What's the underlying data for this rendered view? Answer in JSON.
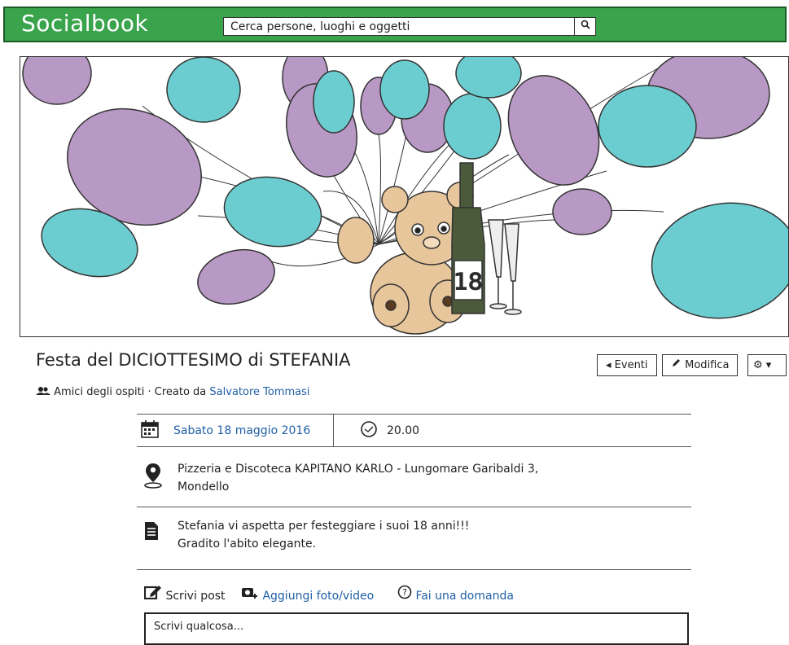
{
  "app": {
    "brand": "Socialbook"
  },
  "search": {
    "placeholder": "Cerca persone, luoghi e oggetti"
  },
  "event": {
    "title": "Festa del DICIOTTESIMO di STEFANIA",
    "privacy": "Amici degli ospiti",
    "created_by_label": "· Creato da",
    "creator": "Salvatore Tommasi",
    "date": "Sabato 18 maggio 2016",
    "time": "20.00",
    "location_line1": "Pizzeria e Discoteca KAPITANO KARLO - Lungomare Garibaldi 3,",
    "location_line2": "Mondello",
    "desc_line1": "Stefania vi aspetta per festeggiare i suoi 18 anni!!!",
    "desc_line2": "Gradito l'abito elegante."
  },
  "buttons": {
    "events": "◂ Eventi",
    "edit": "Modifica",
    "settings": "⚙ ▾"
  },
  "composer": {
    "write_post": "Scrivi post",
    "add_media": "Aggiungi foto/video",
    "ask": "Fai una domanda",
    "placeholder": "Scrivi qualcosa..."
  },
  "cover": {
    "bottle_number": "18"
  },
  "colors": {
    "topbar": "#3aa44c",
    "link": "#1f5fa5",
    "balloon_purple": "#b898c4",
    "balloon_teal": "#6ccdd1",
    "bear": "#e8c69b"
  }
}
